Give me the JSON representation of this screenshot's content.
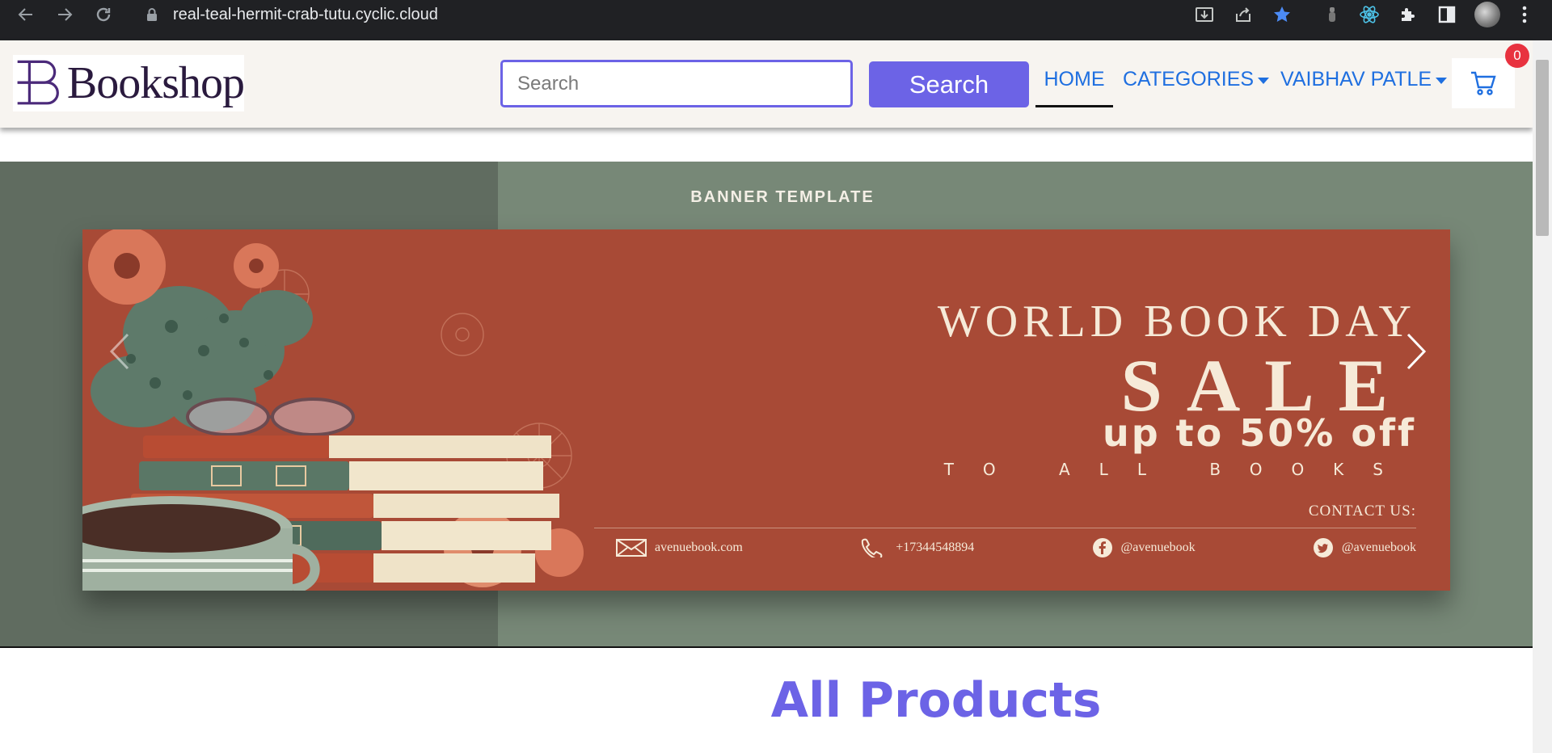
{
  "browser": {
    "url": "real-teal-hermit-crab-tutu.cyclic.cloud"
  },
  "navbar": {
    "logo_text": "Bookshop",
    "search_placeholder": "Search",
    "search_button": "Search",
    "links": {
      "home": "HOME",
      "categories": "CATEGORIES",
      "user": "VAIBHAV PATLE"
    },
    "cart_count": "0"
  },
  "carousel": {
    "caption": "BANNER TEMPLATE",
    "banner": {
      "title": "WORLD BOOK DAY",
      "sale": "SALE",
      "offer": "up to 50% off",
      "subtitle": "TO ALL BOOKS",
      "contact_label": "CONTACT US:",
      "website": "avenuebook.com",
      "phone": "+17344548894",
      "facebook": "@avenuebook",
      "twitter": "@avenuebook"
    }
  },
  "products": {
    "heading": "All Products"
  },
  "colors": {
    "accent": "#6c63e6",
    "link": "#1f6fe0",
    "banner_bg": "#a84a36",
    "carousel_bg": "#778877",
    "badge": "#e8323f"
  }
}
